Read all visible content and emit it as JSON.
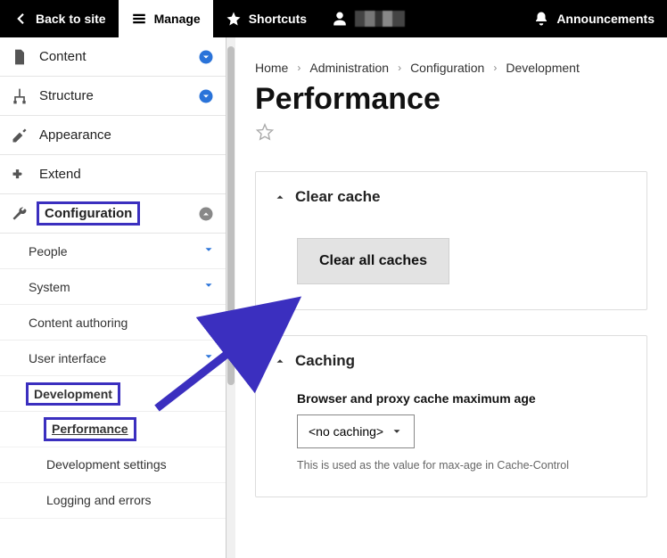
{
  "toolbar": {
    "back": "Back to site",
    "manage": "Manage",
    "shortcuts": "Shortcuts",
    "announcements": "Announcements"
  },
  "sidebar": {
    "content": "Content",
    "structure": "Structure",
    "appearance": "Appearance",
    "extend": "Extend",
    "configuration": "Configuration",
    "config_children": {
      "people": "People",
      "system": "System",
      "content_authoring": "Content authoring",
      "user_interface": "User interface",
      "development": "Development",
      "dev_children": {
        "performance": "Performance",
        "dev_settings": "Development settings",
        "logging": "Logging and errors"
      }
    }
  },
  "breadcrumb": {
    "home": "Home",
    "administration": "Administration",
    "configuration": "Configuration",
    "development": "Development"
  },
  "page": {
    "title": "Performance"
  },
  "panels": {
    "clear_cache": {
      "title": "Clear cache",
      "button": "Clear all caches"
    },
    "caching": {
      "title": "Caching",
      "field_label": "Browser and proxy cache maximum age",
      "select_value": "<no caching>",
      "help": "This is used as the value for max-age in Cache-Control"
    }
  }
}
